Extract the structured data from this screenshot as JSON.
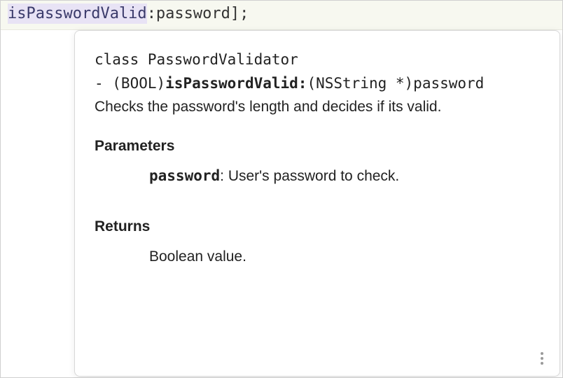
{
  "code": {
    "highlighted": "isPasswordValid",
    "rest": ":password];"
  },
  "doc": {
    "class_prefix": "class ",
    "class_name": "PasswordValidator",
    "sig_prefix": "- (BOOL)",
    "sig_bold": "isPasswordValid:",
    "sig_rest": "(NSString *)password",
    "summary": "Checks the password's length and decides if its valid.",
    "params_heading": "Parameters",
    "param_name": "password",
    "param_sep": ": ",
    "param_desc": "User's password to check.",
    "returns_heading": "Returns",
    "returns_value": "Boolean value."
  }
}
